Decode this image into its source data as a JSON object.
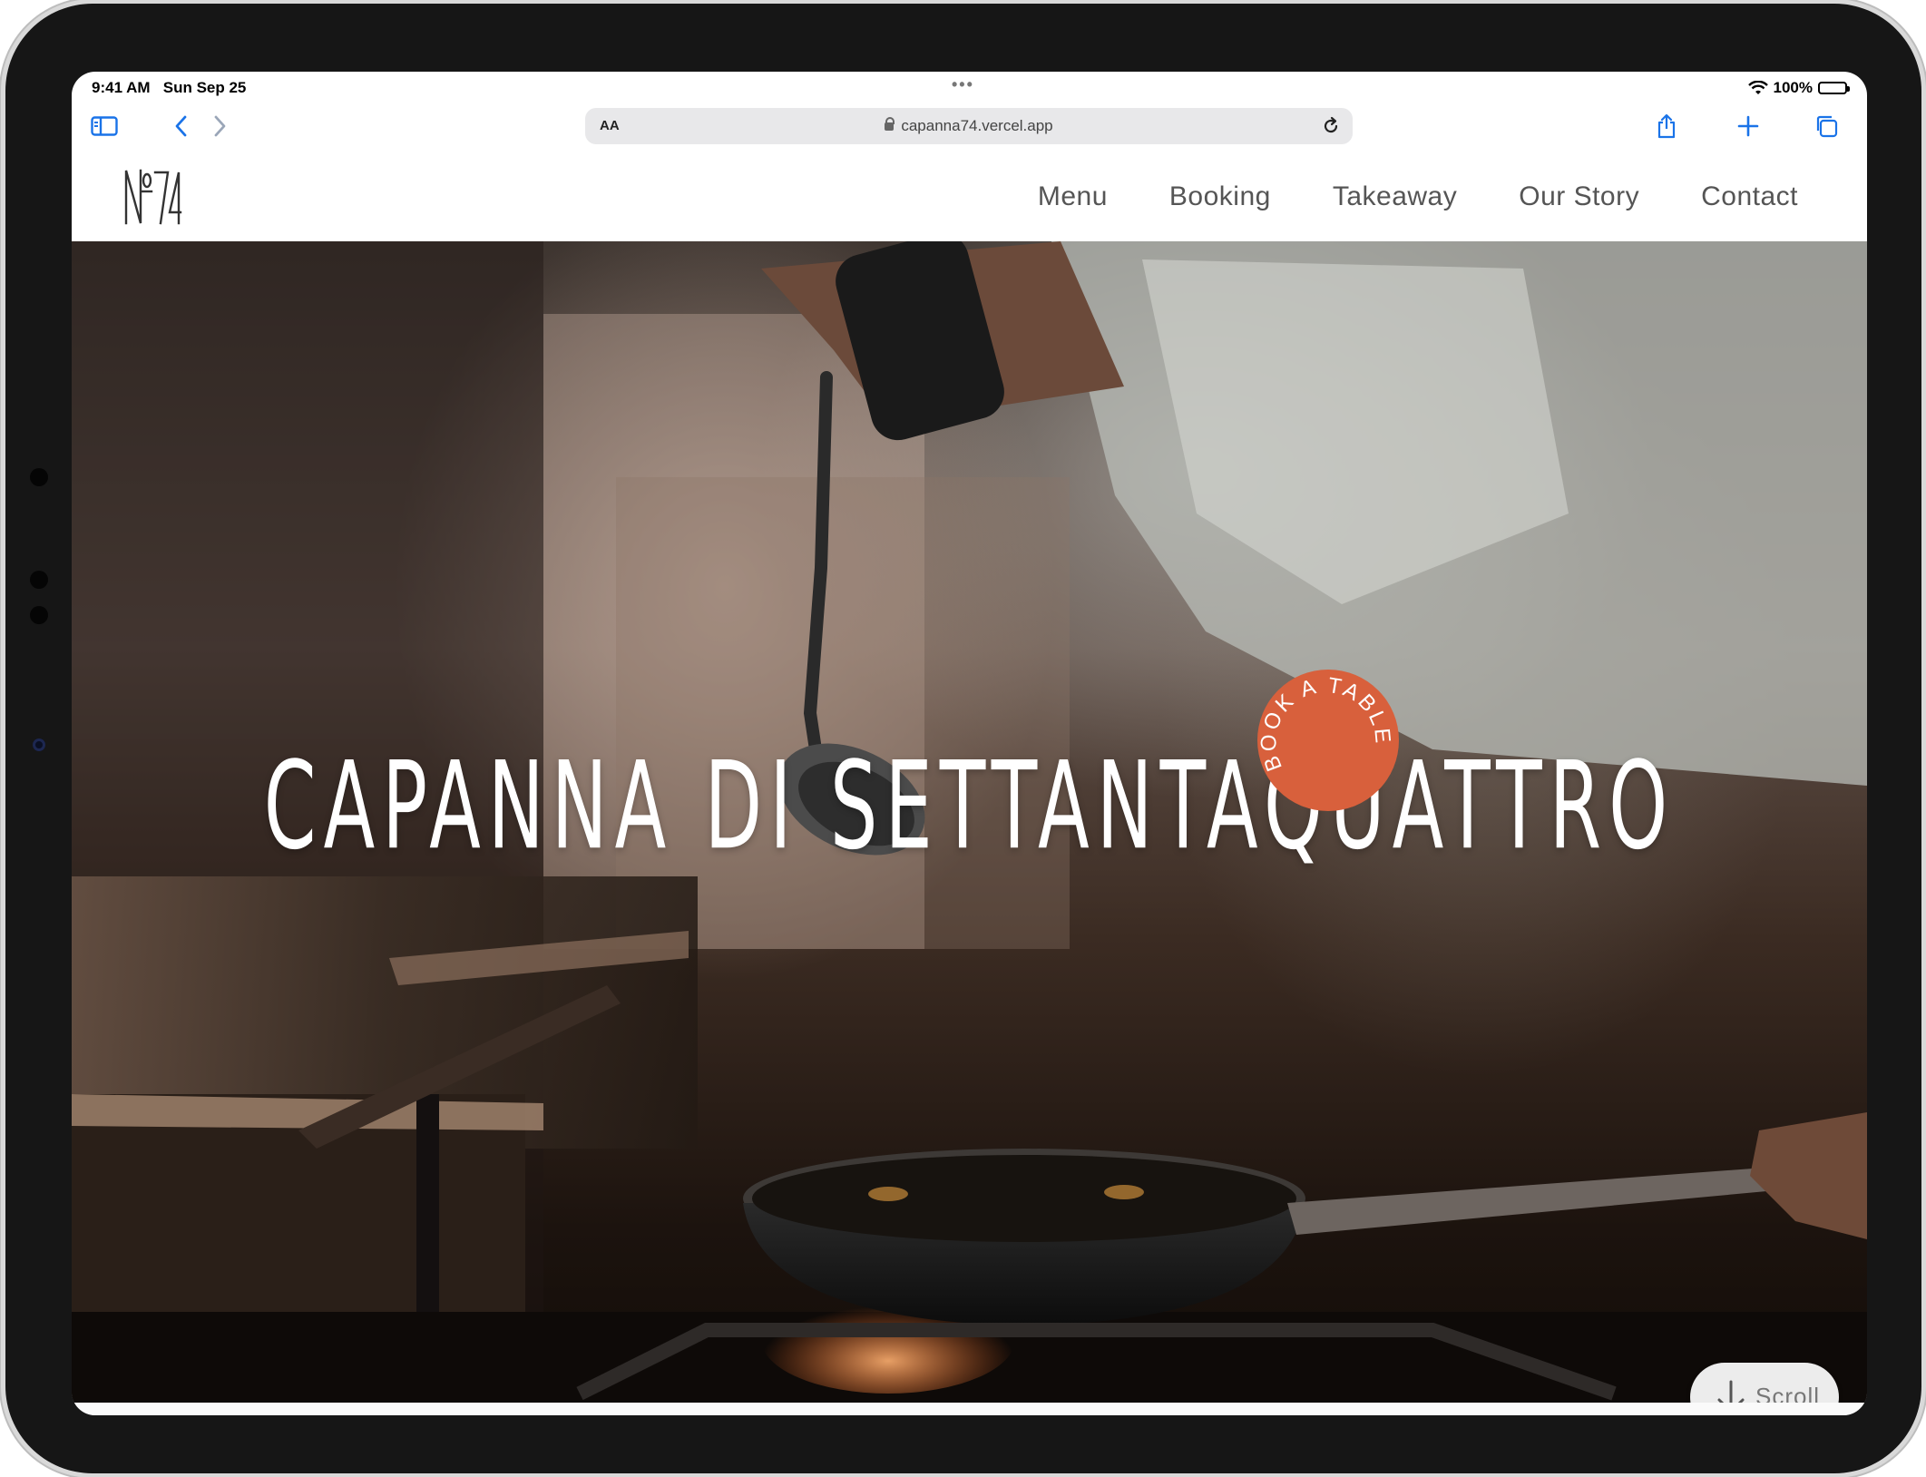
{
  "status_bar": {
    "time": "9:41 AM",
    "date": "Sun Sep 25",
    "battery": "100%",
    "battery_level": 1.0
  },
  "browser": {
    "text_size_label": "AA",
    "url": "capanna74.vercel.app",
    "accent_color": "#1a73e8",
    "icons": [
      "sidebar-icon",
      "back-icon",
      "forward-icon",
      "lock-icon",
      "reload-icon",
      "share-icon",
      "new-tab-icon",
      "tabs-icon"
    ]
  },
  "site": {
    "logo_text": "№74",
    "nav": [
      {
        "label": "Menu"
      },
      {
        "label": "Booking"
      },
      {
        "label": "Takeaway"
      },
      {
        "label": "Our Story"
      },
      {
        "label": "Contact"
      }
    ],
    "hero_title": "CAPANNA DI SETTANTAQUATTRO",
    "book_badge": {
      "text": "BOOK A TABLE",
      "color": "#d8603c"
    },
    "scroll_label": "Scroll"
  }
}
